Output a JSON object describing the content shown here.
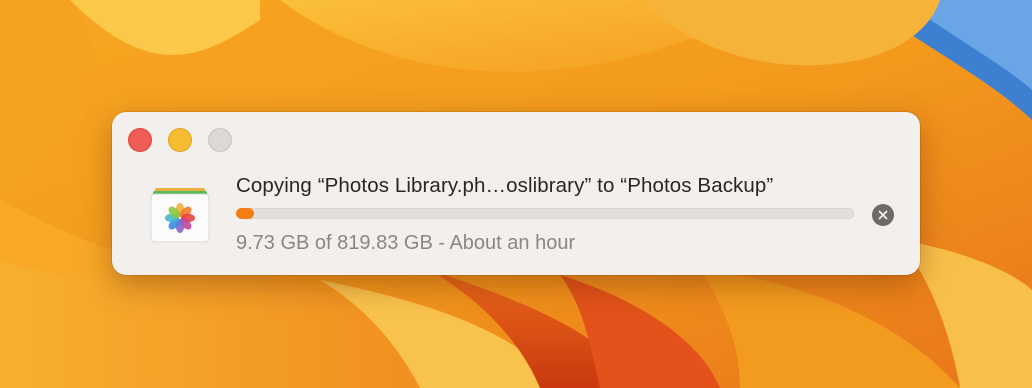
{
  "copy_dialog": {
    "title": "Copying “Photos Library.ph…oslibrary” to “Photos Backup”",
    "status": "9.73 GB of 819.83 GB - About an hour",
    "progress_fraction": 0.0119,
    "progress_color": "#f57d11",
    "file_icon": "photos-library-icon",
    "stop_icon": "stop-x-icon"
  },
  "window_controls": {
    "close_color": "#ee5c55",
    "minimize_color": "#f7bd32",
    "zoom_color": "#dcd8d5"
  }
}
